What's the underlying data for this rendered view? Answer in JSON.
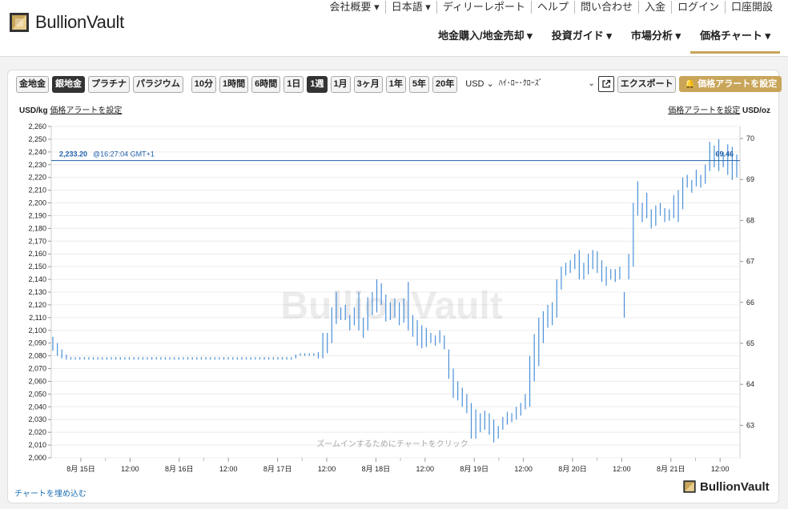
{
  "brand": {
    "name": "BullionVault",
    "accent": "#c9a55a"
  },
  "topnav": [
    "会社概要 ▾",
    "日本語 ▾",
    "ディリーレポート",
    "ヘルプ",
    "問い合わせ",
    "入金",
    "ログイン",
    "口座開設"
  ],
  "mainnav": [
    "地金購入/地金売却 ▾",
    "投資ガイド ▾",
    "市場分析 ▾",
    "価格チャート ▾"
  ],
  "toolbar": {
    "metals": [
      "金地金",
      "銀地金",
      "プラチナ",
      "パラジウム"
    ],
    "active_metal": "銀地金",
    "periods": [
      "10分",
      "1時間",
      "6時間",
      "1日",
      "1週",
      "1月",
      "3ヶ月",
      "1年",
      "5年",
      "20年"
    ],
    "active_period": "1週",
    "currency": "USD",
    "chart_style": "ﾊｲ･ﾛｰ･ｸﾛｰｽﾞ",
    "export_label": "エクスポート",
    "alert_label": "価格アラートを設定"
  },
  "units": {
    "left": "USD/kg",
    "right": "USD/oz",
    "alert_link": "価格アラートを設定"
  },
  "chart_data": {
    "type": "ohlc",
    "y_left": {
      "min": 2000,
      "max": 2260,
      "step": 10,
      "unit": "USD/kg"
    },
    "y_right": {
      "ticks": [
        63,
        64,
        65,
        66,
        67,
        68,
        69,
        70
      ],
      "unit": "USD/oz"
    },
    "x_labels": [
      "8月 15日",
      "12:00",
      "8月 16日",
      "12:00",
      "8月 17日",
      "12:00",
      "8月 18日",
      "12:00",
      "8月 19日",
      "12:00",
      "8月 20日",
      "12:00",
      "8月 21日",
      "12:00"
    ],
    "current": {
      "price_kg": "2,233.20",
      "time": "@16:27:04 GMT+1",
      "price_oz": "69.46",
      "value": 2233.2
    },
    "watermark": "BullionVault",
    "zoom_hint": "ズームインするためにチャートをクリック",
    "bar_color": "#4a90d9",
    "bars": [
      [
        2095,
        2084
      ],
      [
        2090,
        2080
      ],
      [
        2085,
        2078
      ],
      [
        2081,
        2077
      ],
      [
        2079,
        2077
      ],
      [
        2079,
        2077
      ],
      [
        2079,
        2077
      ],
      [
        2079,
        2077
      ],
      [
        2079,
        2077
      ],
      [
        2079,
        2077
      ],
      [
        2079,
        2077
      ],
      [
        2079,
        2077
      ],
      [
        2079,
        2077
      ],
      [
        2079,
        2077
      ],
      [
        2079,
        2077
      ],
      [
        2079,
        2077
      ],
      [
        2079,
        2077
      ],
      [
        2079,
        2077
      ],
      [
        2079,
        2077
      ],
      [
        2079,
        2077
      ],
      [
        2079,
        2077
      ],
      [
        2079,
        2077
      ],
      [
        2079,
        2077
      ],
      [
        2079,
        2077
      ],
      [
        2079,
        2077
      ],
      [
        2079,
        2077
      ],
      [
        2079,
        2077
      ],
      [
        2079,
        2077
      ],
      [
        2079,
        2077
      ],
      [
        2079,
        2077
      ],
      [
        2079,
        2077
      ],
      [
        2079,
        2077
      ],
      [
        2079,
        2077
      ],
      [
        2079,
        2077
      ],
      [
        2079,
        2077
      ],
      [
        2079,
        2077
      ],
      [
        2079,
        2077
      ],
      [
        2079,
        2077
      ],
      [
        2079,
        2077
      ],
      [
        2079,
        2077
      ],
      [
        2079,
        2077
      ],
      [
        2079,
        2077
      ],
      [
        2079,
        2077
      ],
      [
        2079,
        2077
      ],
      [
        2079,
        2077
      ],
      [
        2079,
        2077
      ],
      [
        2079,
        2077
      ],
      [
        2079,
        2077
      ],
      [
        2079,
        2077
      ],
      [
        2079,
        2077
      ],
      [
        2079,
        2077
      ],
      [
        2079,
        2077
      ],
      [
        2079,
        2077
      ],
      [
        2079,
        2077
      ],
      [
        2081,
        2078
      ],
      [
        2082,
        2080
      ],
      [
        2082,
        2080
      ],
      [
        2082,
        2080
      ],
      [
        2082,
        2080
      ],
      [
        2083,
        2078
      ],
      [
        2098,
        2078
      ],
      [
        2098,
        2082
      ],
      [
        2118,
        2090
      ],
      [
        2130,
        2105
      ],
      [
        2118,
        2108
      ],
      [
        2120,
        2108
      ],
      [
        2112,
        2100
      ],
      [
        2118,
        2104
      ],
      [
        2130,
        2100
      ],
      [
        2110,
        2094
      ],
      [
        2126,
        2100
      ],
      [
        2130,
        2112
      ],
      [
        2140,
        2114
      ],
      [
        2137,
        2120
      ],
      [
        2128,
        2107
      ],
      [
        2122,
        2108
      ],
      [
        2125,
        2110
      ],
      [
        2122,
        2104
      ],
      [
        2125,
        2106
      ],
      [
        2138,
        2100
      ],
      [
        2112,
        2095
      ],
      [
        2108,
        2088
      ],
      [
        2104,
        2086
      ],
      [
        2102,
        2087
      ],
      [
        2098,
        2090
      ],
      [
        2096,
        2088
      ],
      [
        2100,
        2090
      ],
      [
        2096,
        2085
      ],
      [
        2085,
        2062
      ],
      [
        2070,
        2047
      ],
      [
        2060,
        2045
      ],
      [
        2055,
        2040
      ],
      [
        2050,
        2035
      ],
      [
        2043,
        2015
      ],
      [
        2038,
        2015
      ],
      [
        2035,
        2020
      ],
      [
        2037,
        2022
      ],
      [
        2035,
        2018
      ],
      [
        2030,
        2012
      ],
      [
        2025,
        2015
      ],
      [
        2032,
        2022
      ],
      [
        2036,
        2026
      ],
      [
        2035,
        2028
      ],
      [
        2040,
        2030
      ],
      [
        2043,
        2033
      ],
      [
        2050,
        2038
      ],
      [
        2080,
        2040
      ],
      [
        2097,
        2060
      ],
      [
        2110,
        2072
      ],
      [
        2115,
        2090
      ],
      [
        2120,
        2102
      ],
      [
        2122,
        2104
      ],
      [
        2140,
        2110
      ],
      [
        2150,
        2132
      ],
      [
        2153,
        2143
      ],
      [
        2155,
        2145
      ],
      [
        2160,
        2148
      ],
      [
        2163,
        2140
      ],
      [
        2153,
        2140
      ],
      [
        2160,
        2144
      ],
      [
        2163,
        2148
      ],
      [
        2162,
        2145
      ],
      [
        2155,
        2138
      ],
      [
        2150,
        2135
      ],
      [
        2148,
        2140
      ],
      [
        2148,
        2138
      ],
      [
        2150,
        2140
      ],
      [
        2130,
        2110
      ],
      [
        2160,
        2140
      ],
      [
        2200,
        2150
      ],
      [
        2217,
        2190
      ],
      [
        2200,
        2185
      ],
      [
        2208,
        2188
      ],
      [
        2195,
        2180
      ],
      [
        2198,
        2182
      ],
      [
        2200,
        2190
      ],
      [
        2196,
        2185
      ],
      [
        2195,
        2186
      ],
      [
        2206,
        2188
      ],
      [
        2210,
        2185
      ],
      [
        2220,
        2195
      ],
      [
        2222,
        2212
      ],
      [
        2218,
        2208
      ],
      [
        2226,
        2213
      ],
      [
        2222,
        2212
      ],
      [
        2230,
        2215
      ],
      [
        2248,
        2225
      ],
      [
        2245,
        2228
      ],
      [
        2250,
        2225
      ],
      [
        2240,
        2228
      ],
      [
        2246,
        2222
      ],
      [
        2244,
        2218
      ],
      [
        2238,
        2220
      ]
    ]
  }
}
